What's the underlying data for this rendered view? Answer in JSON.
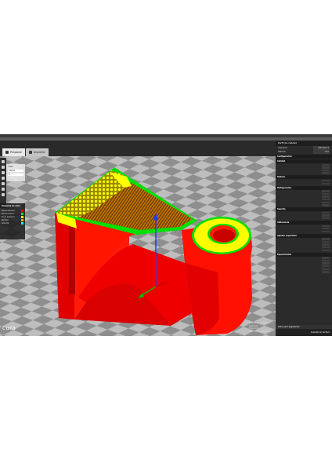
{
  "app": {
    "logo": "cura"
  },
  "tabs": [
    {
      "label": "Preparar",
      "icon": "prepare-icon"
    },
    {
      "label": "Imprimir",
      "icon": "monitor-icon"
    }
  ],
  "view_panel": {
    "title": "Vista",
    "rows": [
      "Capas",
      "5"
    ]
  },
  "legend": {
    "title": "Esquema de color",
    "items": [
      {
        "label": "Pared exterior",
        "color": "#ff0000"
      },
      {
        "label": "Pared interior",
        "color": "#00ff00"
      },
      {
        "label": "Forro superior",
        "color": "#ffff00"
      },
      {
        "label": "Relleno",
        "color": "#ffb000"
      },
      {
        "label": "Soporte",
        "color": "#00ffff"
      }
    ]
  },
  "status": {
    "line1": "Tiempo de impresión estimado",
    "line2": "Filamento",
    "line3": "Listo para segmentar"
  },
  "right_panel": {
    "header": "Perfil de calidad",
    "kv": [
      {
        "k": "Impresora",
        "v": "Ultimaker 2"
      },
      {
        "k": "Material",
        "v": "PLA"
      }
    ],
    "config_label": "Configuración",
    "sections": [
      {
        "title": "Calidad",
        "rows": 4
      },
      {
        "title": "Relleno",
        "rows": 2
      },
      {
        "title": "Refrigeración",
        "rows": 6
      },
      {
        "title": "Soporte",
        "rows": 3
      },
      {
        "title": "Adherencia",
        "rows": 3
      },
      {
        "title": "Ajustes especiales",
        "rows": 5
      },
      {
        "title": "Experimental",
        "rows": 6
      }
    ],
    "prepare_label": "Listo para segmentar",
    "prepare_button": "Guardar en archivo"
  },
  "colors": {
    "outer_wall": "#ff0000",
    "inner_wall": "#00ff00",
    "top": "#ffff00",
    "infill": "#e8a000",
    "floor_dark": "#8c8c8c",
    "floor_light": "#c8c8c8"
  }
}
